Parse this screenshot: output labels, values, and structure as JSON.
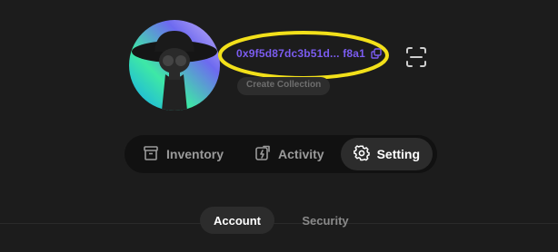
{
  "profile": {
    "address": "0x9f5d87dc3b51d... f8a1",
    "chip_label": "Create Collection"
  },
  "icons": {
    "copy": "copy-icon",
    "scan": "scan-icon",
    "inventory": "inventory-box-icon",
    "activity": "activity-icon",
    "setting": "gear-icon"
  },
  "tabs": [
    {
      "label": "Inventory",
      "active": false
    },
    {
      "label": "Activity",
      "active": false
    },
    {
      "label": "Setting",
      "active": true
    }
  ],
  "subtabs": [
    {
      "label": "Account",
      "active": true
    },
    {
      "label": "Security",
      "active": false
    }
  ],
  "colors": {
    "background": "#1c1c1c",
    "address_accent": "#7b5cf0",
    "highlight_ring": "#f2e01a"
  }
}
